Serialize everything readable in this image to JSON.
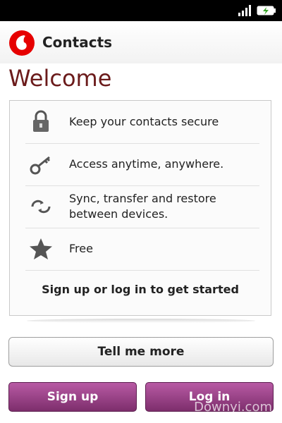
{
  "app": {
    "title": "Contacts",
    "brand_color": "#e60000"
  },
  "welcome": {
    "heading": "Welcome"
  },
  "features": [
    {
      "icon": "lock-icon",
      "label": "Keep your contacts secure"
    },
    {
      "icon": "key-icon",
      "label": "Access anytime, anywhere."
    },
    {
      "icon": "sync-icon",
      "label": "Sync, transfer and restore between devices."
    },
    {
      "icon": "star-icon",
      "label": "Free"
    }
  ],
  "card": {
    "cta": "Sign up or log in to get started"
  },
  "buttons": {
    "tell_more": "Tell me more",
    "sign_up": "Sign up",
    "log_in": "Log in"
  },
  "colors": {
    "accent_purple": "#9b3f8a",
    "welcome_text": "#6b1b1b"
  },
  "watermark": "Downyi.com"
}
